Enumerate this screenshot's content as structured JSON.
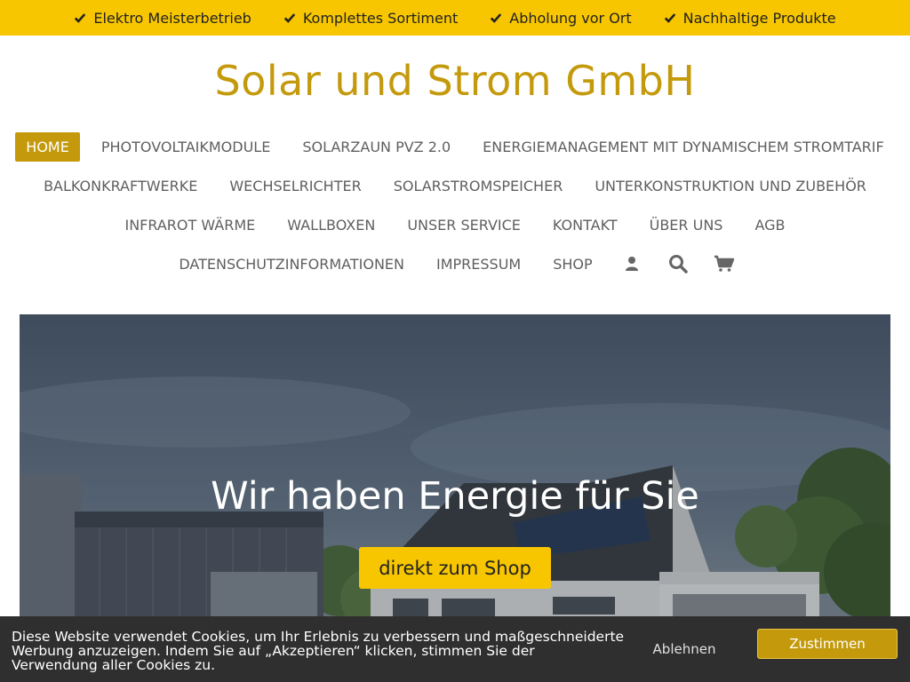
{
  "topbar": {
    "items": [
      {
        "label": "Elektro Meisterbetrieb",
        "icon": "check-icon"
      },
      {
        "label": "Komplettes Sortiment",
        "icon": "check-icon"
      },
      {
        "label": "Abholung vor Ort",
        "icon": "check-icon"
      },
      {
        "label": "Nachhaltige Produkte",
        "icon": "check-icon"
      }
    ],
    "background": "#f7c600"
  },
  "site": {
    "title": "Solar und Strom GmbH",
    "accent": "#c49a0c"
  },
  "nav": {
    "rows": [
      [
        "HOME",
        "PHOTOVOLTAIKMODULE",
        "SOLARZAUN PVZ 2.0",
        "ENERGIEMANAGEMENT MIT DYNAMISCHEM STROMTARIF"
      ],
      [
        "BALKONKRAFTWERKE",
        "WECHSELRICHTER",
        "SOLARSTROMSPEICHER",
        "UNTERKONSTRUKTION UND ZUBEHÖR"
      ],
      [
        "INFRAROT WÄRME",
        "WALLBOXEN",
        "UNSER SERVICE",
        "KONTAKT",
        "ÜBER UNS",
        "AGB"
      ],
      [
        "DATENSCHUTZINFORMATIONEN",
        "IMPRESSUM",
        "SHOP"
      ]
    ],
    "active": "HOME",
    "icons": [
      "user-icon",
      "search-icon",
      "cart-icon"
    ]
  },
  "hero": {
    "title": "Wir haben Energie für Sie",
    "button_label": "direkt zum Shop"
  },
  "cookie": {
    "text": "Diese Website verwendet Cookies, um Ihr Erlebnis zu verbessern und maßgeschneiderte Werbung anzuzeigen. Indem Sie auf „Akzeptieren“ klicken, stimmen Sie der Verwendung aller Cookies zu.",
    "decline_label": "Ablehnen",
    "accept_label": "Zustimmen"
  }
}
